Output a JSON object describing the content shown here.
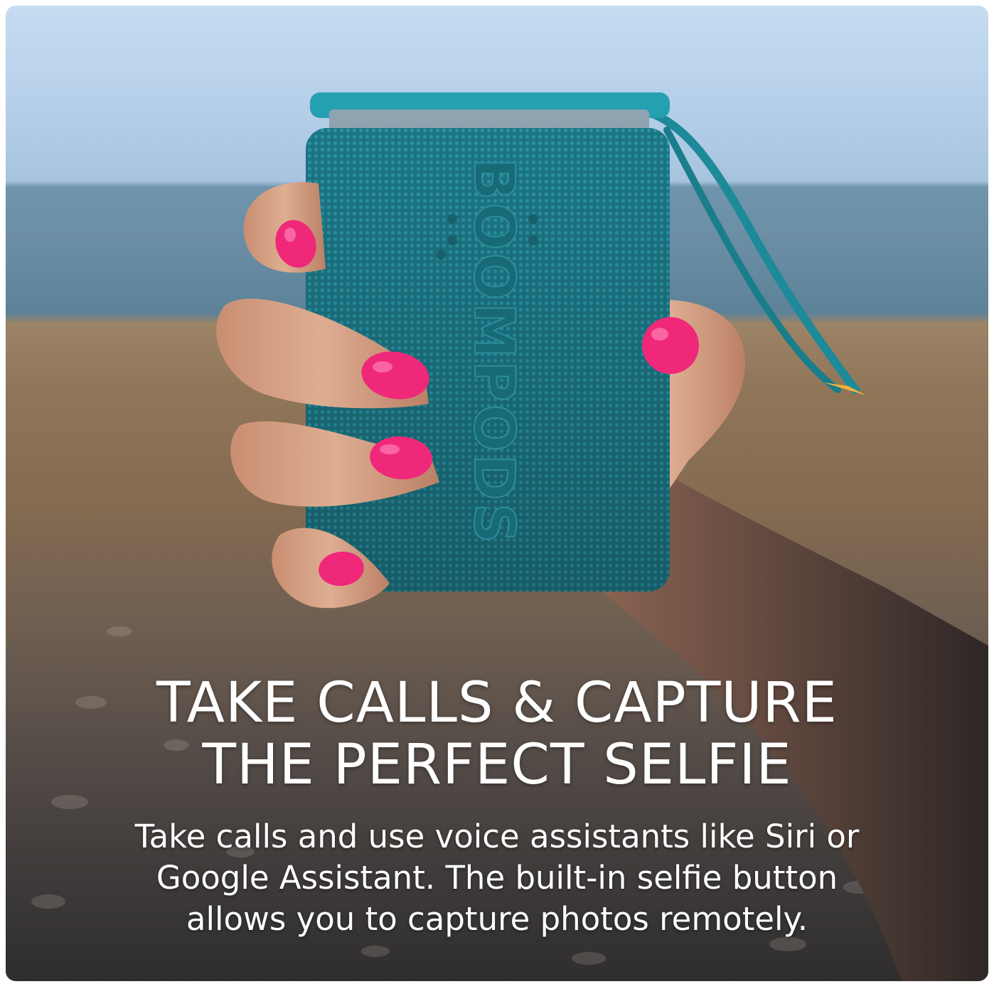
{
  "headline": {
    "line1": "TAKE CALLS & CAPTURE",
    "line2": "THE PERFECT SELFIE"
  },
  "body": {
    "line1": "Take calls and use voice assistants like Siri or",
    "line2": "Google Assistant. The built-in selfie button",
    "line3": "allows you to capture photos remotely."
  },
  "product": {
    "brand_mark": "BOOMPODS"
  },
  "colors": {
    "speaker_teal": "#1f7f8e",
    "nail_pink": "#f0287a",
    "text": "#ffffff"
  }
}
